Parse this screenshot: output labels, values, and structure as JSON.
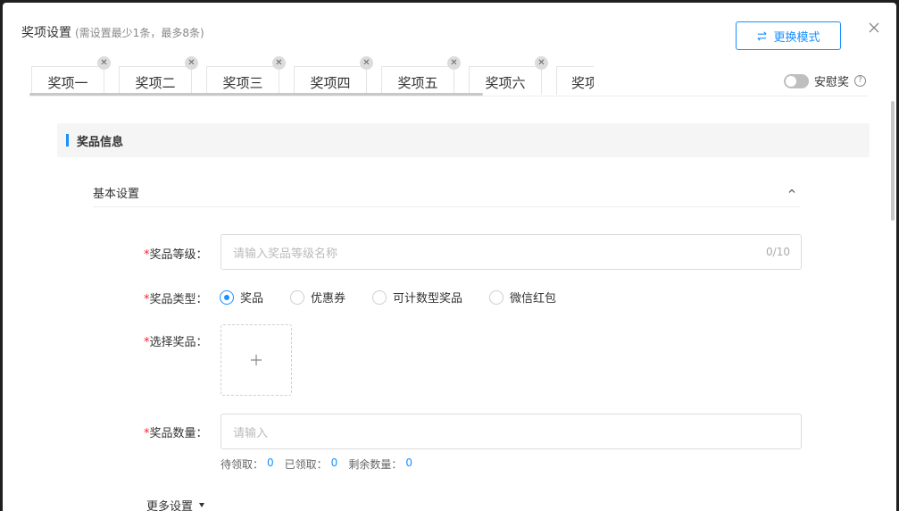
{
  "dialog": {
    "title": "奖项设置",
    "subtitle": "(需设置最少1条，最多8条)",
    "mode_button": "更换模式",
    "close_icon": "close-icon"
  },
  "tabs": [
    {
      "label": "奖项一"
    },
    {
      "label": "奖项二"
    },
    {
      "label": "奖项三"
    },
    {
      "label": "奖项四"
    },
    {
      "label": "奖项五"
    },
    {
      "label": "奖项六"
    },
    {
      "label": "奖项"
    }
  ],
  "consolation": {
    "label": "安慰奖",
    "enabled": false
  },
  "section": {
    "title": "奖品信息"
  },
  "basic": {
    "title": "基本设置",
    "expanded": true
  },
  "form": {
    "level": {
      "label": "奖品等级：",
      "placeholder": "请输入奖品等级名称",
      "count": "0/10"
    },
    "type": {
      "label": "奖品类型：",
      "options": [
        "奖品",
        "优惠券",
        "可计数型奖品",
        "微信红包"
      ],
      "selected": "奖品"
    },
    "select": {
      "label": "选择奖品："
    },
    "quantity": {
      "label": "奖品数量：",
      "placeholder": "请输入"
    },
    "stats": {
      "pending_label": "待领取：",
      "pending": "0",
      "claimed_label": "已领取：",
      "claimed": "0",
      "remaining_label": "剩余数量：",
      "remaining": "0"
    }
  },
  "more": {
    "label": "更多设置"
  },
  "colors": {
    "accent": "#1890ff",
    "required": "#f5222d"
  }
}
